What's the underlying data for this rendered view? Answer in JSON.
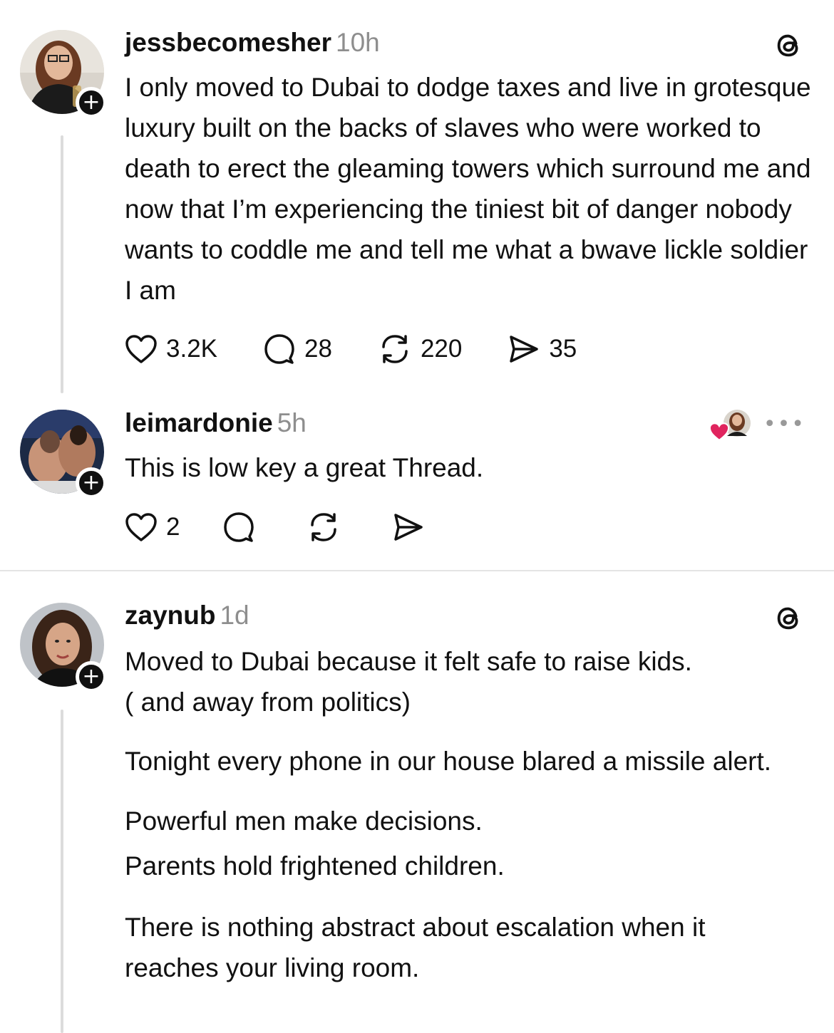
{
  "posts": [
    {
      "username": "jessbecomesher",
      "time": "10h",
      "text_lines": [
        "I only moved to Dubai to dodge taxes and live in grotesque luxury built on the backs of slaves who were worked to death to erect the gleaming towers which surround me and now that I’m experiencing the tiniest bit of danger nobody wants to coddle me and tell me what a bwave lickle soldier I am"
      ],
      "likes": "3.2K",
      "replies": "28",
      "reposts": "220",
      "shares": "35"
    },
    {
      "username": "leimardonie",
      "time": "5h",
      "text_lines": [
        "This is low key a great Thread."
      ],
      "likes": "2",
      "more_label": "•••"
    },
    {
      "username": "zaynub",
      "time": "1d",
      "paragraphs": [
        "Moved to Dubai because it felt safe to raise kids.\n( and away from politics)",
        "Tonight every phone in our house blared a missile alert.",
        "Powerful men make decisions.\nParents hold frightened children.",
        "There is nothing abstract about escalation when it reaches your living room."
      ]
    }
  ],
  "icons": {
    "threads_logo": "threads-icon",
    "like": "heart-icon",
    "reply": "comment-icon",
    "repost": "repost-icon",
    "share": "send-icon",
    "follow": "plus-icon"
  },
  "follow_label": "+",
  "colors": {
    "text": "#111111",
    "muted": "#8e8e8e",
    "liked": "#e0245e"
  }
}
